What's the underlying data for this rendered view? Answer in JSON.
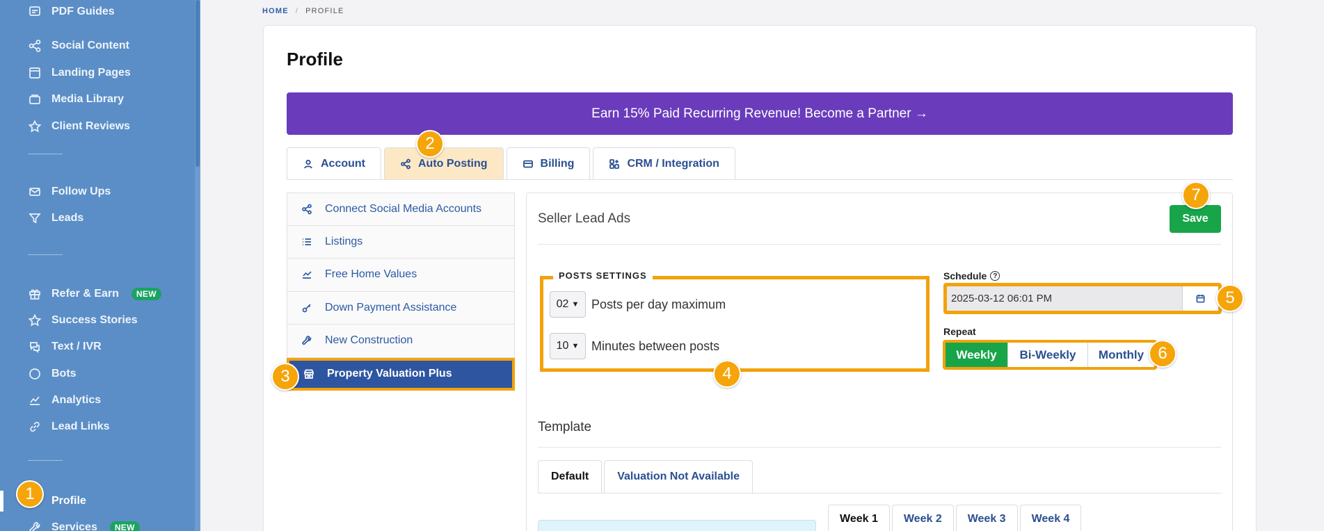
{
  "sidebar": {
    "items": [
      {
        "label": "PDF Guides",
        "icon": "pdf-icon"
      },
      {
        "label": "Social Content",
        "icon": "share-icon"
      },
      {
        "label": "Landing Pages",
        "icon": "page-icon"
      },
      {
        "label": "Media Library",
        "icon": "folder-icon"
      },
      {
        "label": "Client Reviews",
        "icon": "star-icon"
      },
      {
        "label": "Follow Ups",
        "icon": "mail-icon"
      },
      {
        "label": "Leads",
        "icon": "filter-icon"
      },
      {
        "label": "Refer & Earn",
        "icon": "gift-icon",
        "badge": "NEW"
      },
      {
        "label": "Success Stories",
        "icon": "star-icon"
      },
      {
        "label": "Text / IVR",
        "icon": "sms-icon"
      },
      {
        "label": "Bots",
        "icon": "chat-icon"
      },
      {
        "label": "Analytics",
        "icon": "analytics-icon"
      },
      {
        "label": "Lead Links",
        "icon": "link-icon"
      },
      {
        "label": "Profile",
        "icon": "user-icon"
      },
      {
        "label": "Services",
        "icon": "wrench-icon",
        "badge": "NEW"
      }
    ]
  },
  "markers": [
    "1",
    "2",
    "3",
    "4",
    "5",
    "6",
    "7"
  ],
  "breadcrumb": {
    "home": "HOME",
    "separator": "/",
    "current": "PROFILE"
  },
  "page": {
    "title": "Profile",
    "promo": "Earn 15% Paid Recurring Revenue! Become a Partner →"
  },
  "tabs": [
    {
      "label": "Account",
      "icon": "user-icon"
    },
    {
      "label": "Auto Posting",
      "icon": "share-icon",
      "active": true
    },
    {
      "label": "Billing",
      "icon": "card-icon"
    },
    {
      "label": "CRM / Integration",
      "icon": "integration-icon"
    }
  ],
  "submenu": [
    {
      "label": "Connect Social Media Accounts",
      "icon": "share-icon"
    },
    {
      "label": "Listings",
      "icon": "list-icon"
    },
    {
      "label": "Free Home Values",
      "icon": "chart-icon"
    },
    {
      "label": "Down Payment Assistance",
      "icon": "key-icon"
    },
    {
      "label": "New Construction",
      "icon": "tools-icon"
    },
    {
      "label": "Property Valuation Plus",
      "icon": "store-icon",
      "active": true
    }
  ],
  "panel": {
    "title": "Seller Lead Ads",
    "save": "Save",
    "posts_settings": {
      "heading": "POSTS SETTINGS",
      "posts_per_day": {
        "value": "02",
        "label": "Posts per day maximum"
      },
      "minutes_between": {
        "value": "10",
        "label": "Minutes between posts"
      }
    },
    "schedule": {
      "label": "Schedule",
      "help": "?",
      "value": "2025-03-12 06:01 PM"
    },
    "repeat": {
      "label": "Repeat",
      "options": [
        "Weekly",
        "Bi-Weekly",
        "Monthly"
      ],
      "selected": "Weekly"
    },
    "template": {
      "label": "Template",
      "tabs": [
        "Default",
        "Valuation Not Available"
      ],
      "weeks": [
        "Week 1",
        "Week 2",
        "Week 3",
        "Week 4"
      ]
    }
  },
  "colors": {
    "sidebar": "#5b8ec7",
    "accent": "#2a4f92",
    "highlight": "#f2a20c",
    "success": "#18a54a",
    "promo": "#6a3cbc"
  }
}
